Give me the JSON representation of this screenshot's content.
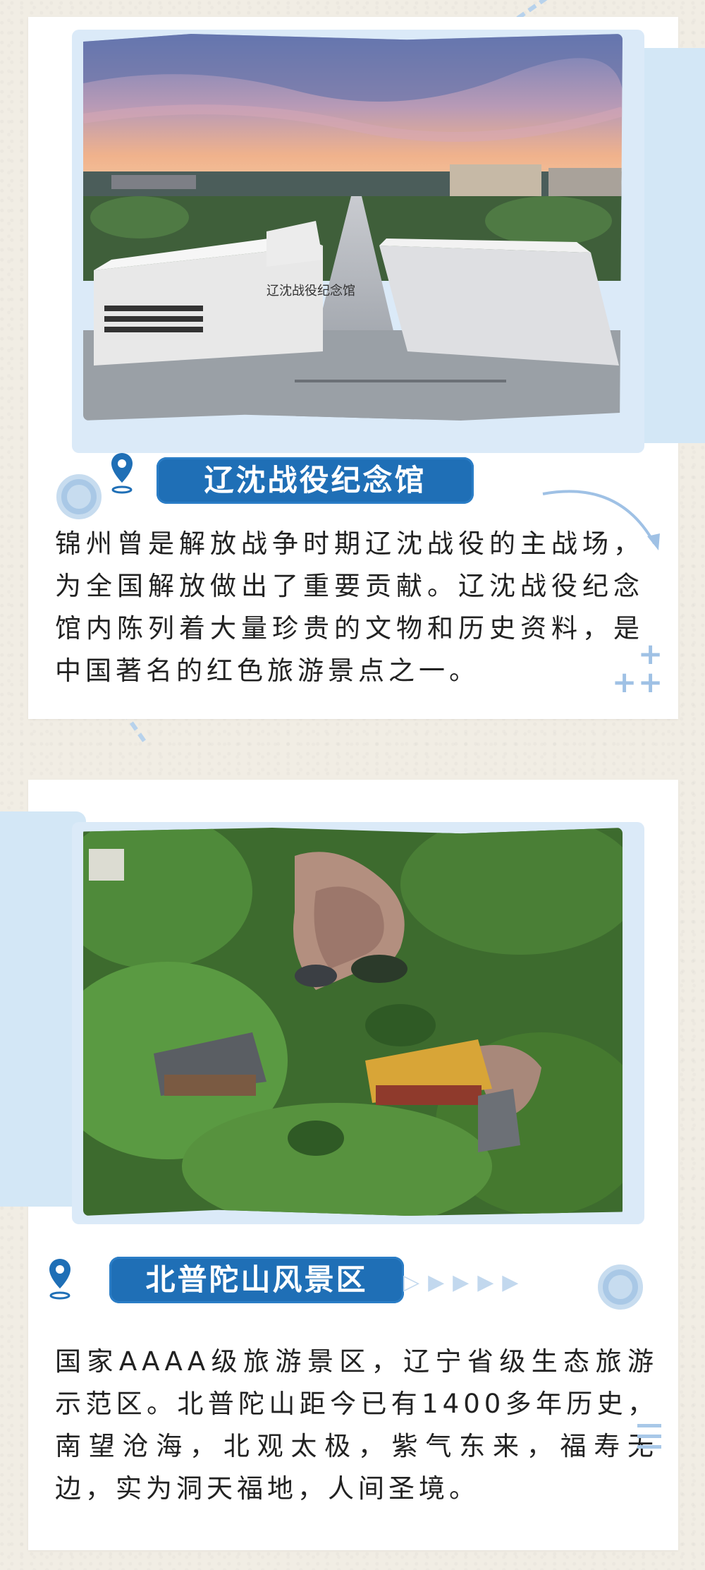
{
  "colors": {
    "background": "#f1ede4",
    "card": "#ffffff",
    "accent_blue": "#1f6fb6",
    "light_blue": "#d3e7f6",
    "text": "#222222"
  },
  "sections": [
    {
      "title": "辽沈战役纪念馆",
      "photo_sign_text": "辽沈战役纪念馆",
      "body": "锦州曾是解放战争时期辽沈战役的主战场，为全国解放做出了重要贡献。辽沈战役纪念馆内陈列着大量珍贵的文物和历史资料，是中国著名的红色旅游景点之一。"
    },
    {
      "title": "北普陀山风景区",
      "body": "国家AAAA级旅游景区，辽宁省级生态旅游示范区。北普陀山距今已有1400多年历史，南望沧海，北观太极，紫气东来，福寿无边，实为洞天福地，人间圣境。"
    }
  ],
  "icons": [
    "map-pin-icon",
    "target-ring-icon",
    "curved-arrow-icon",
    "play-arrows-icon",
    "plus-icon"
  ]
}
